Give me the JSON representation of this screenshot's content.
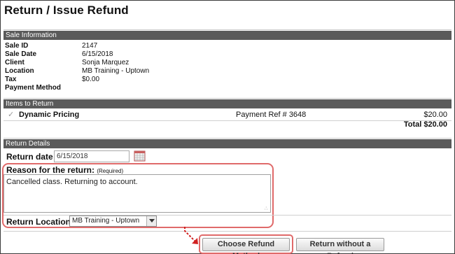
{
  "page": {
    "title": "Return / Issue Refund"
  },
  "sale_info": {
    "header": "Sale Information",
    "rows": [
      {
        "label": "Sale ID",
        "value": "2147"
      },
      {
        "label": "Sale Date",
        "value": "6/15/2018"
      },
      {
        "label": "Client",
        "value": "Sonja Marquez"
      },
      {
        "label": "Location",
        "value": "MB Training - Uptown"
      },
      {
        "label": "Tax",
        "value": "$0.00"
      },
      {
        "label": "Payment Method",
        "value": ""
      }
    ]
  },
  "items": {
    "header": "Items to Return",
    "rows": [
      {
        "name": "Dynamic Pricing",
        "ref": "Payment Ref # 3648",
        "price": "$20.00",
        "checked": true
      }
    ],
    "total": "Total $20.00"
  },
  "return_details": {
    "header": "Return Details",
    "date_label": "Return date",
    "date_value": "6/15/2018",
    "reason_label": "Reason for the return:",
    "reason_required": "(Required)",
    "reason_text": "Cancelled class. Returning to account.",
    "location_label": "Return Location:",
    "location_value": "MB Training - Uptown"
  },
  "actions": {
    "choose_refund": "Choose Refund Method",
    "return_without": "Return without a Refund"
  },
  "colors": {
    "section_bar": "#5a5a5a",
    "highlight": "#e06a6a"
  },
  "icons": {
    "check": "check-icon",
    "calendar": "calendar-icon",
    "dropdown": "chevron-down-icon"
  }
}
